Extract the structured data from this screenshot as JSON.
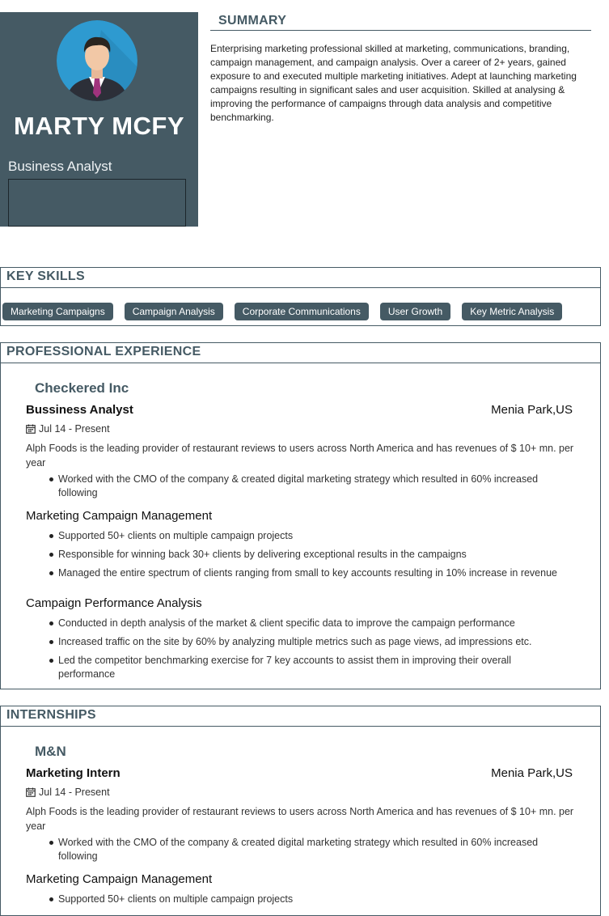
{
  "profile": {
    "name": "MARTY MCFY",
    "role": "Business Analyst"
  },
  "summary": {
    "heading": "SUMMARY",
    "text": "Enterprising marketing professional skilled at marketing, communications, branding, campaign management, and campaign analysis. Over a career of 2+ years, gained exposure to and executed multiple marketing initiatives. Adept at launching marketing campaigns resulting in significant sales and user acquisition. Skilled at analysing & improving the performance of campaigns through data analysis and competitive benchmarking."
  },
  "skills": {
    "heading": "KEY SKILLS",
    "items": [
      "Marketing Campaigns",
      "Campaign Analysis",
      "Corporate Communications",
      "User Growth",
      "Key Metric Analysis"
    ]
  },
  "experience": {
    "heading": "PROFESSIONAL EXPERIENCE",
    "company": "Checkered Inc",
    "title": "Bussiness Analyst",
    "location": "Menia Park,US",
    "dates": "Jul 14 - Present",
    "description": "Alph Foods is the leading provider of restaurant reviews to users across North America and has revenues of $ 10+ mn. per year",
    "bullets": [
      "Worked with the CMO of the company & created digital marketing strategy which resulted in 60% increased following"
    ],
    "groups": [
      {
        "title": "Marketing Campaign Management",
        "bullets": [
          "Supported 50+ clients on multiple campaign projects",
          "Responsible for winning back 30+ clients by delivering exceptional results in the campaigns",
          "Managed the entire spectrum of clients ranging from small to key accounts resulting in 10% increase in revenue"
        ]
      },
      {
        "title": "Campaign Performance Analysis",
        "bullets": [
          "Conducted in depth analysis of the market & client specific data to improve the campaign performance",
          "Increased traffic on the site by 60% by analyzing multiple metrics such as page views, ad impressions etc.",
          "Led the competitor benchmarking exercise for 7 key accounts to assist them in improving their overall performance"
        ]
      }
    ]
  },
  "internships": {
    "heading": "INTERNSHIPS",
    "company": "M&N",
    "title": "Marketing Intern",
    "location": "Menia Park,US",
    "dates": "Jul 14 - Present",
    "description": "Alph Foods is the leading provider of restaurant reviews to users across North America and has revenues of $ 10+ mn. per year",
    "bullets": [
      "Worked with the CMO of the company & created digital marketing strategy which resulted in 60% increased following"
    ],
    "groups": [
      {
        "title": "Marketing Campaign Management",
        "bullets": [
          "Supported 50+ clients on multiple campaign projects"
        ]
      }
    ]
  },
  "colors": {
    "accent": "#455a64",
    "chip_text": "#ffffff"
  }
}
